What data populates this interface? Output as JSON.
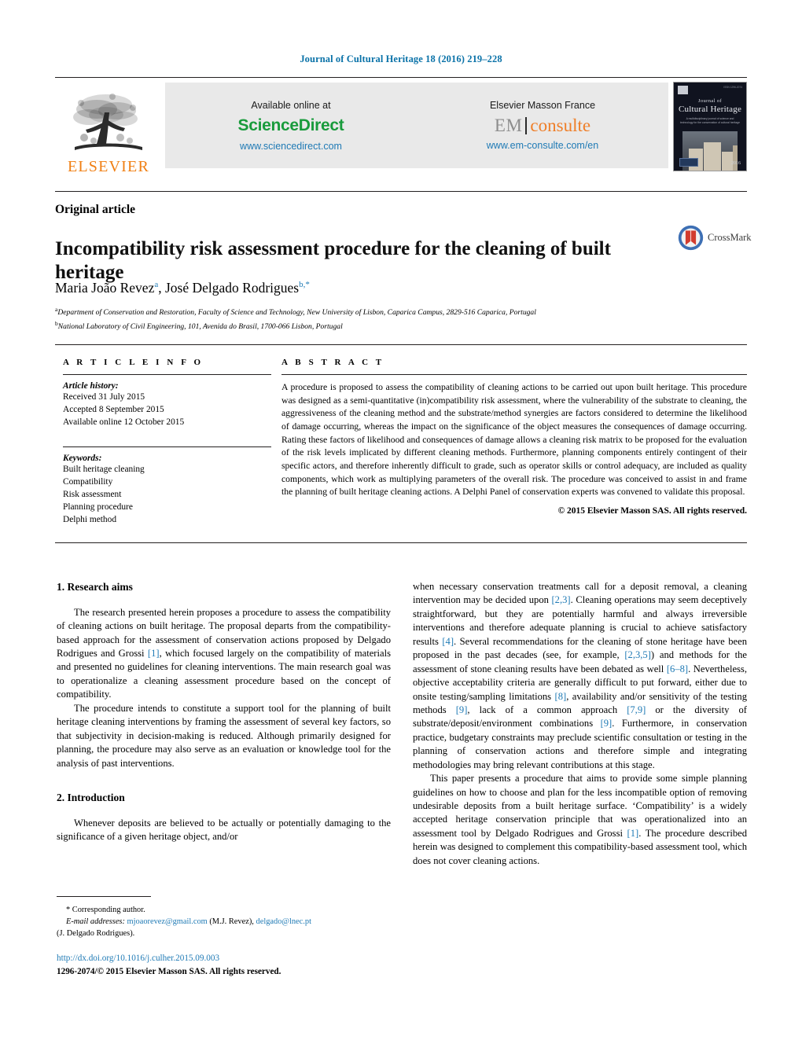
{
  "running_head": "Journal of Cultural Heritage 18 (2016) 219–228",
  "masthead": {
    "publisher_wordmark": "ELSEVIER",
    "sciencedirect": {
      "lead": "Available online at",
      "brand": "ScienceDirect",
      "url": "www.sciencedirect.com"
    },
    "emconsulte": {
      "lead": "Elsevier Masson France",
      "brand_left": "EM",
      "brand_right": "consulte",
      "url": "www.em-consulte.com/en"
    },
    "cover": {
      "journal_word": "Journal of",
      "journal_name": "Cultural Heritage",
      "subtitle": "A multidisciplinary journal of science and technology for the conservation of cultural heritage",
      "year": "2016",
      "issn": "ISSN 1296-2074"
    }
  },
  "article": {
    "type": "Original article",
    "title": "Incompatibility risk assessment procedure for the cleaning of built heritage",
    "crossmark_label": "CrossMark",
    "authors_html": "Maria João Revez<sup>a</sup>, José Delgado Rodrigues<sup class=\"plain\">b,&#42;</sup>",
    "affiliations": [
      {
        "marker": "a",
        "text": "Department of Conservation and Restoration, Faculty of Science and Technology, New University of Lisbon, Caparica Campus, 2829-516 Caparica, Portugal"
      },
      {
        "marker": "b",
        "text": "National Laboratory of Civil Engineering, 101, Avenida do Brasil, 1700-066 Lisbon, Portugal"
      }
    ]
  },
  "article_info": {
    "heading": "A R T I C L E  I N F O",
    "history_label": "Article history:",
    "history": [
      "Received 31 July 2015",
      "Accepted 8 September 2015",
      "Available online 12 October 2015"
    ],
    "keywords_label": "Keywords:",
    "keywords": [
      "Built heritage cleaning",
      "Compatibility",
      "Risk assessment",
      "Planning procedure",
      "Delphi method"
    ]
  },
  "abstract": {
    "heading": "A B S T R A C T",
    "text": "A procedure is proposed to assess the compatibility of cleaning actions to be carried out upon built heritage. This procedure was designed as a semi-quantitative (in)compatibility risk assessment, where the vulnerability of the substrate to cleaning, the aggressiveness of the cleaning method and the substrate/method synergies are factors considered to determine the likelihood of damage occurring, whereas the impact on the significance of the object measures the consequences of damage occurring. Rating these factors of likelihood and consequences of damage allows a cleaning risk matrix to be proposed for the evaluation of the risk levels implicated by different cleaning methods. Furthermore, planning components entirely contingent of their specific actors, and therefore inherently difficult to grade, such as operator skills or control adequacy, are included as quality components, which work as multiplying parameters of the overall risk. The procedure was conceived to assist in and frame the planning of built heritage cleaning actions. A Delphi Panel of conservation experts was convened to validate this proposal.",
    "copyright": "© 2015 Elsevier Masson SAS. All rights reserved."
  },
  "body": {
    "section1": {
      "heading": "1.  Research aims",
      "p1_a": "The research presented herein proposes a procedure to assess the compatibility of cleaning actions on built heritage. The proposal departs from the compatibility-based approach for the assessment of conservation actions proposed by Delgado Rodrigues and Grossi ",
      "p1_ref": "[1]",
      "p1_b": ", which focused largely on the compatibility of materials and presented no guidelines for cleaning interventions. The main research goal was to operationalize a cleaning assessment procedure based on the concept of compatibility.",
      "p2": "The procedure intends to constitute a support tool for the planning of built heritage cleaning interventions by framing the assessment of several key factors, so that subjectivity in decision-making is reduced. Although primarily designed for planning, the procedure may also serve as an evaluation or knowledge tool for the analysis of past interventions."
    },
    "section2": {
      "heading": "2.  Introduction",
      "p1": "Whenever deposits are believed to be actually or potentially damaging to the significance of a given heritage object, and/or",
      "p1_cont_a": "when necessary conservation treatments call for a deposit removal, a cleaning intervention may be decided upon ",
      "r1": "[2,3]",
      "p1_cont_b": ". Cleaning operations may seem deceptively straightforward, but they are potentially harmful and always irreversible interventions and therefore adequate planning is crucial to achieve satisfactory results ",
      "r2": "[4]",
      "p1_cont_c": ". Several recommendations for the cleaning of stone heritage have been proposed in the past decades (see, for example, ",
      "r3": "[2,3,5]",
      "p1_cont_d": ") and methods for the assessment of stone cleaning results have been debated as well ",
      "r4": "[6–8]",
      "p1_cont_e": ". Nevertheless, objective acceptability criteria are generally difficult to put forward, either due to onsite testing/sampling limitations ",
      "r5": "[8]",
      "p1_cont_f": ", availability and/or sensitivity of the testing methods ",
      "r6": "[9]",
      "p1_cont_g": ", lack of a common approach ",
      "r7": "[7,9]",
      "p1_cont_h": " or the diversity of substrate/deposit/environment combinations ",
      "r8": "[9]",
      "p1_cont_i": ". Furthermore, in conservation practice, budgetary constraints may preclude scientific consultation or testing in the planning of conservation actions and therefore simple and integrating methodologies may bring relevant contributions at this stage.",
      "p2_a": "This paper presents a procedure that aims to provide some simple planning guidelines on how to choose and plan for the less incompatible option of removing undesirable deposits from a built heritage surface. ‘Compatibility’ is a widely accepted heritage conservation principle that was operationalized into an assessment tool by Delgado Rodrigues and Grossi ",
      "p2_ref": "[1]",
      "p2_b": ". The procedure described herein was designed to complement this compatibility-based assessment tool, which does not cover cleaning actions."
    }
  },
  "footnote": {
    "corresponding": "*  Corresponding author.",
    "email_label": "E-mail addresses:",
    "email1": "mjoaorevez@gmail.com",
    "email1_who": "(M.J. Revez),",
    "email2": "delgado@lnec.pt",
    "email2_who": "(J. Delgado Rodrigues)."
  },
  "footer": {
    "doi": "http://dx.doi.org/10.1016/j.culher.2015.09.003",
    "issn_line": "1296-2074/© 2015 Elsevier Masson SAS. All rights reserved."
  },
  "colors": {
    "link_blue": "#1f7ab5",
    "elsevier_orange": "#f07f13",
    "sciencedirect_green": "#199b3c",
    "emconsulte_orange": "#ef7f29"
  }
}
